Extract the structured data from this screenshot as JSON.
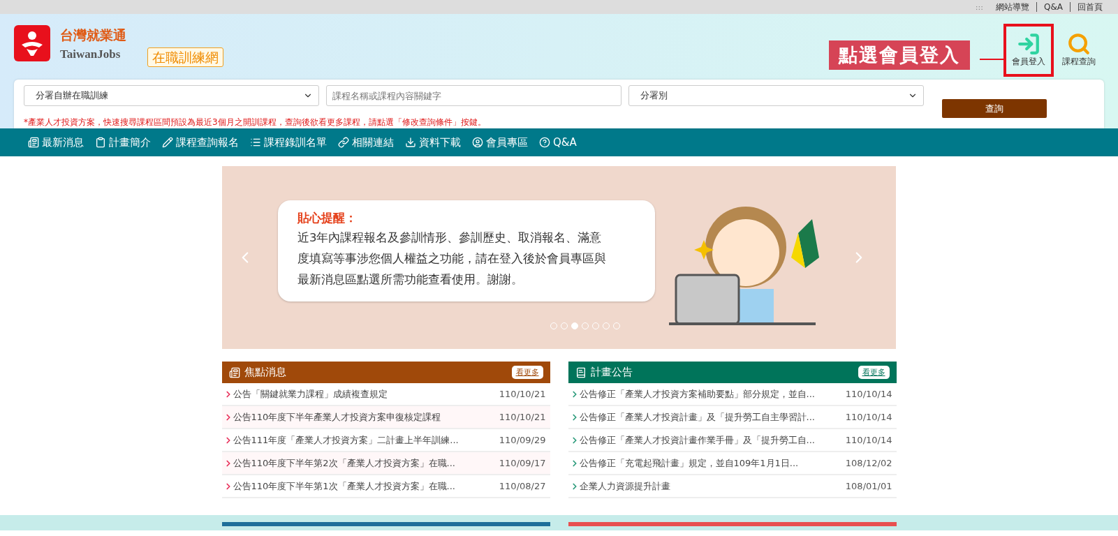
{
  "top_links": [
    {
      "label": "網站導覽"
    },
    {
      "label": "Q&A"
    },
    {
      "label": "回首頁"
    }
  ],
  "top_mark": ":::",
  "logo": {
    "name": "台灣就業通",
    "name_en": "TaiwanJobs",
    "site_badge": "在職訓練網"
  },
  "annotation": {
    "label": "點選會員登入"
  },
  "header_actions": [
    {
      "label": "會員登入",
      "kind": "login",
      "highlighted": true
    },
    {
      "label": "課程查詢",
      "kind": "search",
      "highlighted": false
    }
  ],
  "search": {
    "category": "分署自辦在職訓練",
    "keyword_placeholder": "課程名稱或課程內容關鍵字",
    "branch": "分署別",
    "button": "查詢",
    "notice": "*產業人才投資方案，快速搜尋課程區間預設為最近3個月之開訓課程，查詢後欲看更多課程，請點選「修改查詢條件」按鍵。"
  },
  "nav": [
    {
      "label": "最新消息",
      "kind": "news"
    },
    {
      "label": "計畫簡介",
      "kind": "clipboard"
    },
    {
      "label": "課程查詢報名",
      "kind": "pencil"
    },
    {
      "label": "課程錄訓名單",
      "kind": "list"
    },
    {
      "label": "相關連結",
      "kind": "link"
    },
    {
      "label": "資料下載",
      "kind": "download"
    },
    {
      "label": "會員專區",
      "kind": "user"
    },
    {
      "label": "Q&A",
      "kind": "help"
    }
  ],
  "banner": {
    "title": "貼心提醒：",
    "body_lines": [
      "近3年內課程報名及參訓情形、參訓歷史、取消報名、滿意",
      "度填寫等事涉您個人權益之功能，請在登入後於會員專區與",
      "最新消息區點選所需功能查看使用。謝謝。"
    ],
    "dots": [
      {
        "selected": false
      },
      {
        "selected": false
      },
      {
        "selected": true
      },
      {
        "selected": false
      },
      {
        "selected": false
      },
      {
        "selected": false
      },
      {
        "selected": false
      }
    ]
  },
  "panels": [
    {
      "title": "焦點消息",
      "kind": "news",
      "color": "#a0490a",
      "more": "看更多",
      "items": [
        {
          "title": "公告「關鍵就業力課程」成績複查規定",
          "date": "110/10/21"
        },
        {
          "title": "公告110年度下半年產業人才投資方案申復核定課程",
          "date": "110/10/21"
        },
        {
          "title": "公告111年度「產業人才投資方案」二計畫上半年訓練...",
          "date": "110/09/29"
        },
        {
          "title": "公告110年度下半年第2次「產業人才投資方案」在職...",
          "date": "110/09/17"
        },
        {
          "title": "公告110年度下半年第1次「產業人才投資方案」在職...",
          "date": "110/08/27"
        }
      ]
    },
    {
      "title": "計畫公告",
      "kind": "plan",
      "color": "#00745a",
      "more": "看更多",
      "items": [
        {
          "title": "公告修正「產業人才投資方案補助要點」部分規定，並自...",
          "date": "110/10/14"
        },
        {
          "title": "公告修正「產業人才投資計畫」及「提升勞工自主學習計...",
          "date": "110/10/14"
        },
        {
          "title": "公告修正「產業人才投資計畫作業手冊」及「提升勞工自...",
          "date": "110/10/14"
        },
        {
          "title": "公告修正「充電起飛計畫」規定，並自109年1月1日...",
          "date": "108/12/02"
        },
        {
          "title": "企業人力資源提升計畫",
          "date": "108/01/01"
        }
      ]
    }
  ]
}
